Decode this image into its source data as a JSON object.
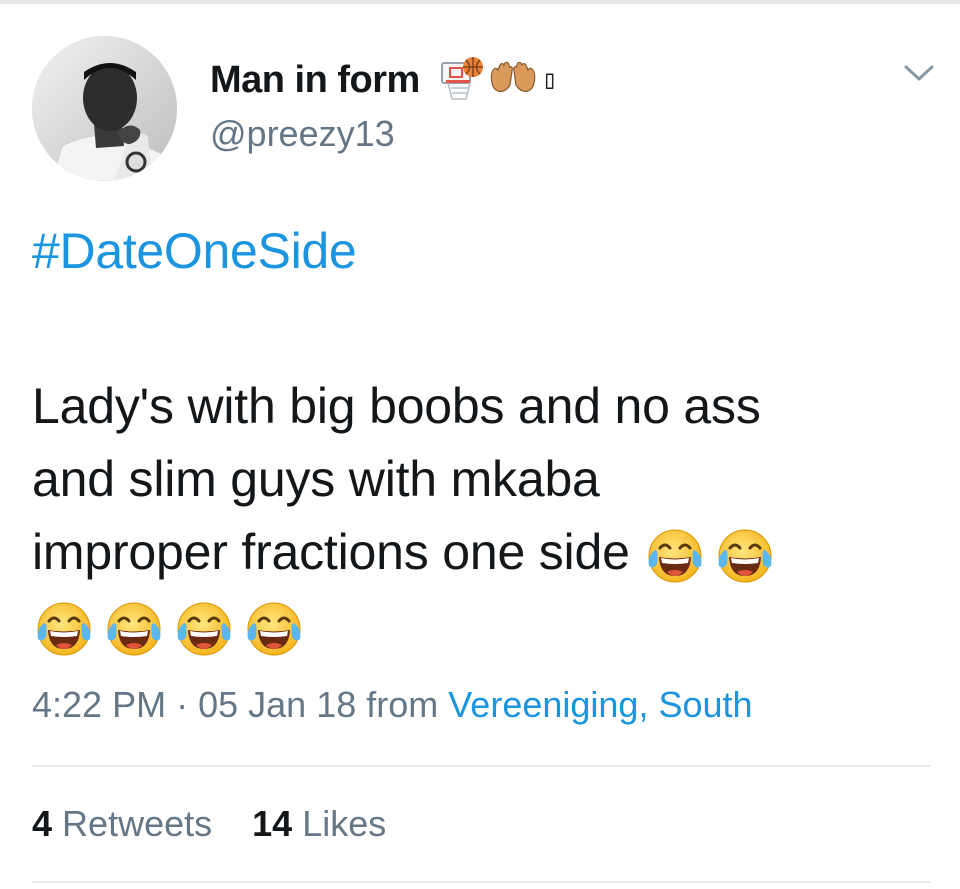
{
  "user": {
    "display_name": "Man in form",
    "name_emojis": [
      "basketball-hoop-icon",
      "raised-hands-icon",
      "missing-glyph-icon"
    ],
    "missing_glyph": "▯",
    "handle": "@preezy13"
  },
  "tweet": {
    "hashtag": "#DateOneSide",
    "text_lines": [
      "Lady's with big boobs and no ass",
      "and slim guys with mkaba",
      "improper fractions one side"
    ],
    "joy_emoji_count_line3": 2,
    "joy_emoji_count_line4": 4
  },
  "meta": {
    "time": "4:22 PM",
    "separator": "·",
    "date": "05 Jan 18",
    "from_label": "from",
    "location": "Vereeniging, South"
  },
  "stats": {
    "retweets_count": "4",
    "retweets_label": "Retweets",
    "likes_count": "14",
    "likes_label": "Likes"
  },
  "colors": {
    "link": "#1b95e0",
    "secondary": "#657786",
    "primary_text": "#14171a",
    "divider": "#e6ecf0"
  }
}
